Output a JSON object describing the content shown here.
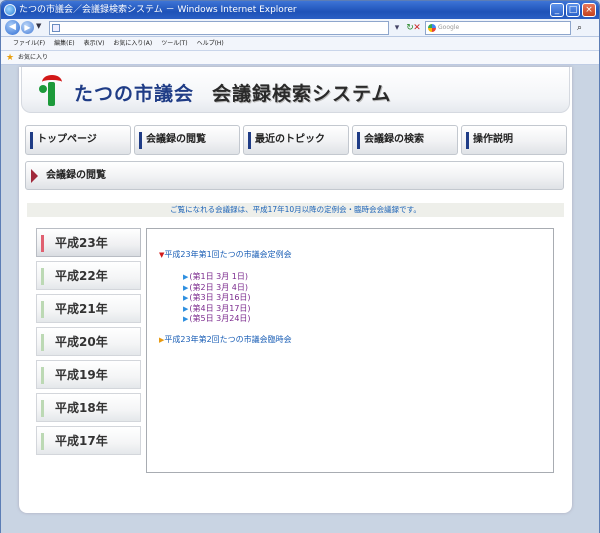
{
  "browser": {
    "title": "たつの市議会／会議録検索システム － Windows Internet Explorer",
    "url": "",
    "search_placeholder": "Google",
    "menu": [
      "ファイル(F)",
      "編集(E)",
      "表示(V)",
      "お気に入り(A)",
      "ツール(T)",
      "ヘルプ(H)"
    ],
    "favorites_label": "お気に入り",
    "controls": {
      "minimize": "_",
      "maximize": "□",
      "close": "×"
    }
  },
  "site": {
    "name_part1": "たつの市議会",
    "name_part2": "会議録検索システム",
    "nav": [
      "トップページ",
      "会議録の閲覧",
      "最近のトピック",
      "会議録の検索",
      "操作説明"
    ],
    "breadcrumb": "会議録の閲覧",
    "notice": "ご覧になれる会議録は、平成17年10月以降の定例会・臨時会会議録です。"
  },
  "years": [
    "平成23年",
    "平成22年",
    "平成21年",
    "平成20年",
    "平成19年",
    "平成18年",
    "平成17年"
  ],
  "sessions": [
    {
      "title": "平成23年第1回たつの市議会定例会",
      "expanded": true,
      "days": [
        "(第1日 3月 1日)",
        "(第2日 3月 4日)",
        "(第3日 3月16日)",
        "(第4日 3月17日)",
        "(第5日 3月24日)"
      ]
    },
    {
      "title": "平成23年第2回たつの市議会臨時会",
      "expanded": false,
      "days": []
    }
  ],
  "colors": {
    "nav_accent": "#1f3c86",
    "active_year_accent": "#e06070",
    "link": "#1b5fb6",
    "visited": "#7b2a8e"
  }
}
